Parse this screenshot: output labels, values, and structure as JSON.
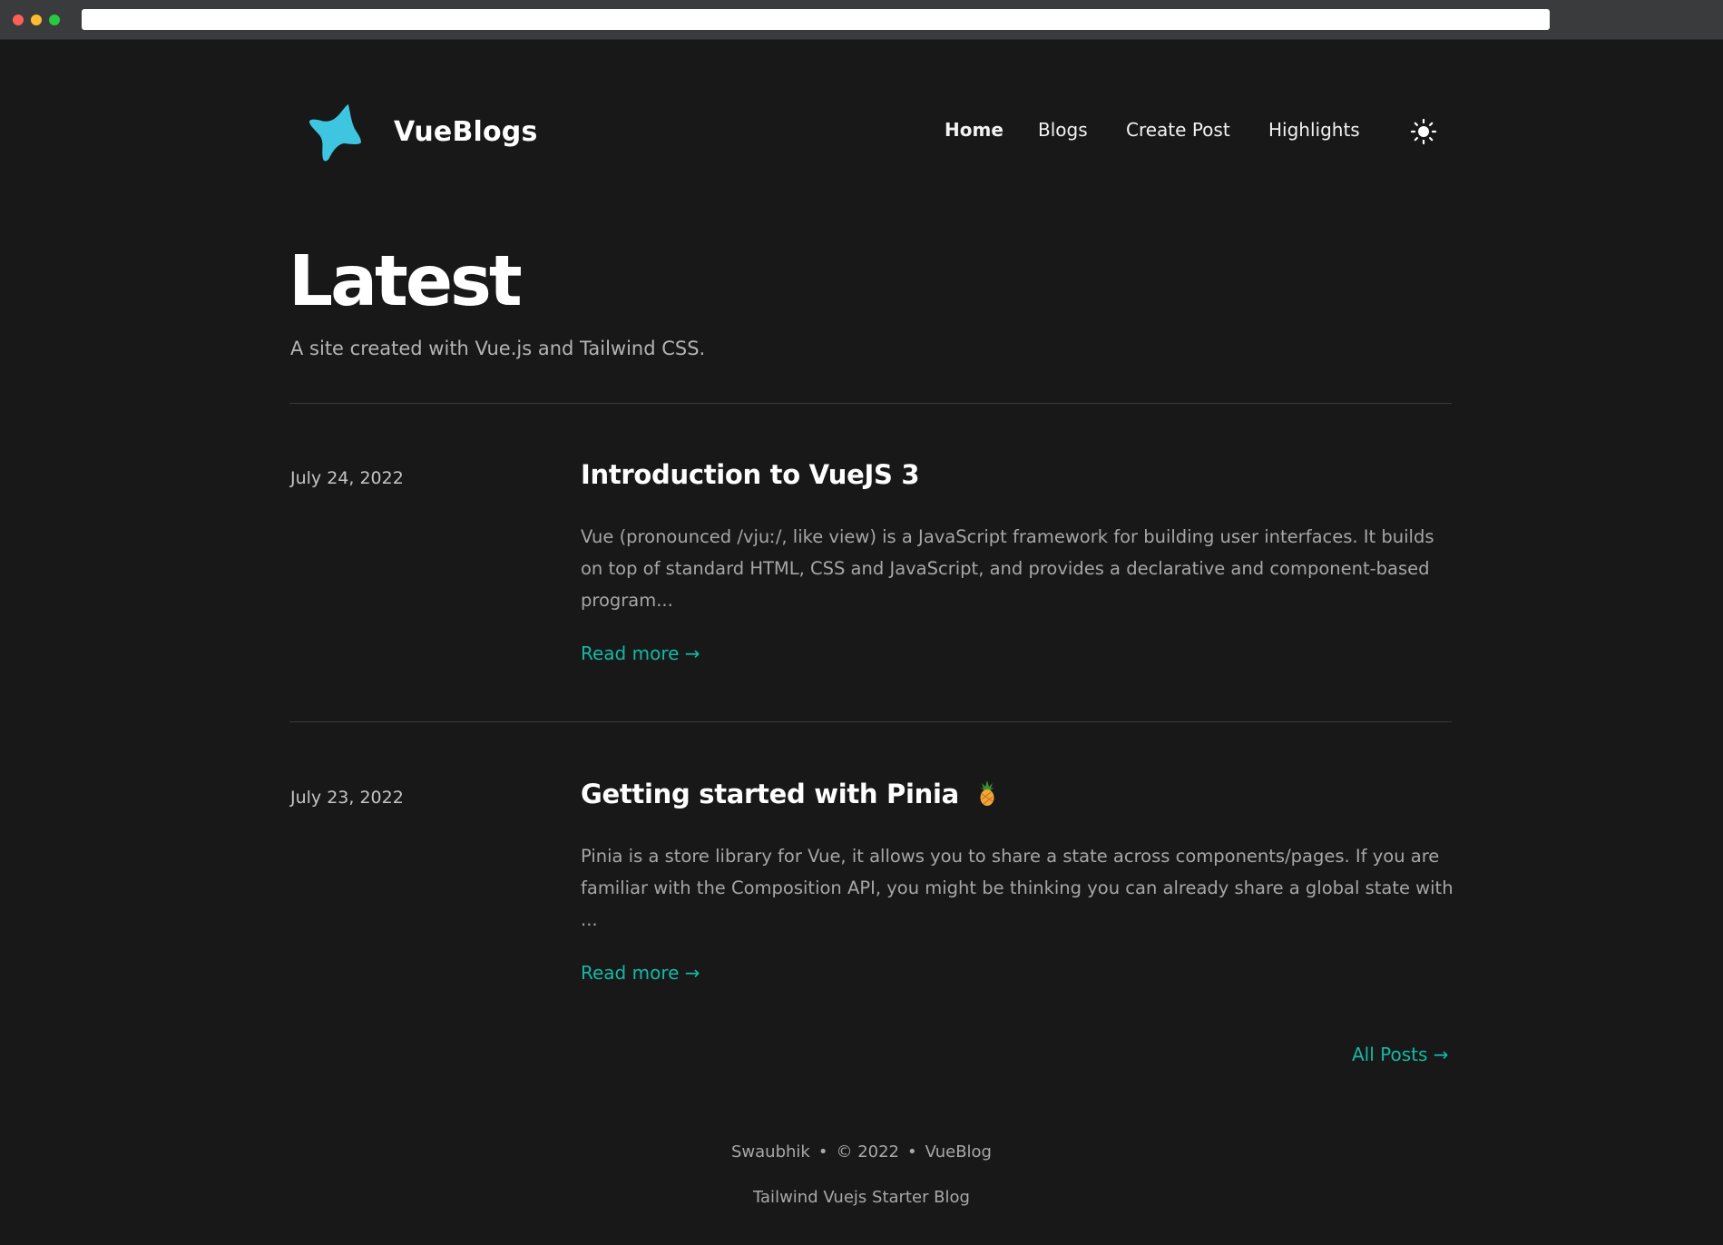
{
  "header": {
    "brand": "VueBlogs",
    "logo_icon": "star-sparkle-icon",
    "nav": {
      "home": "Home",
      "blogs": "Blogs",
      "create_post": "Create Post",
      "highlights": "Highlights"
    },
    "theme_toggle_icon": "sun-icon"
  },
  "hero": {
    "title": "Latest",
    "subtitle": "A site created with Vue.js and Tailwind CSS."
  },
  "posts": [
    {
      "date": "July 24, 2022",
      "title": "Introduction to VueJS 3",
      "excerpt": "Vue (pronounced /vjuː/, like view) is a JavaScript framework for building user interfaces. It builds on top of standard HTML, CSS and JavaScript, and provides a declarative and component-based program...",
      "read_more": "Read more →"
    },
    {
      "date": "July 23, 2022",
      "title": "Getting started with Pinia",
      "title_icon": "pineapple-icon",
      "excerpt": "Pinia is a store library for Vue, it allows you to share a state across components/pages. If you are familiar with the Composition API, you might be thinking you can already share a global state with ...",
      "read_more": "Read more →"
    }
  ],
  "all_posts": "All Posts →",
  "footer": {
    "author": "Swaubhik",
    "separator": "•",
    "copyright": "© 2022",
    "site": "VueBlog",
    "tagline": "Tailwind Vuejs Starter Blog"
  },
  "colors": {
    "background": "#181818",
    "accent": "#14b8a6",
    "logo": "#3ec6e0"
  }
}
